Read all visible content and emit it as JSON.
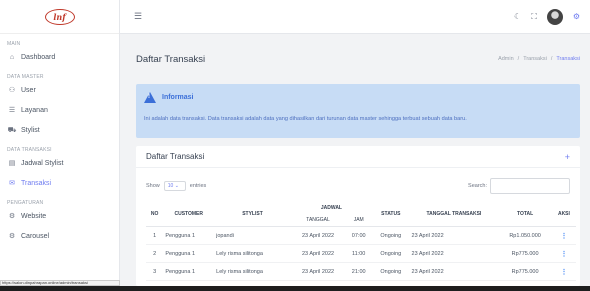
{
  "logo_text": "lnf",
  "sidebar": {
    "sections": [
      {
        "title": "MAIN",
        "items": [
          {
            "label": "Dashboard",
            "icon": "home-icon",
            "glyph": "⌂",
            "active": false
          }
        ]
      },
      {
        "title": "DATA MASTER",
        "items": [
          {
            "label": "User",
            "icon": "users-icon",
            "glyph": "⚇",
            "active": false
          },
          {
            "label": "Layanan",
            "icon": "list-icon",
            "glyph": "☰",
            "active": false
          },
          {
            "label": "Stylist",
            "icon": "car-icon",
            "glyph": "⛟",
            "active": false
          }
        ]
      },
      {
        "title": "DATA TRANSAKSI",
        "items": [
          {
            "label": "Jadwal Stylist",
            "icon": "clipboard-icon",
            "glyph": "▤",
            "active": false
          },
          {
            "label": "Transaksi",
            "icon": "message-icon",
            "glyph": "✉",
            "active": true
          }
        ]
      },
      {
        "title": "PENGATURAN",
        "items": [
          {
            "label": "Website",
            "icon": "gears-icon",
            "glyph": "⚙",
            "active": false
          },
          {
            "label": "Carousel",
            "icon": "gears-icon",
            "glyph": "⚙",
            "active": false
          }
        ]
      }
    ]
  },
  "status_url": "https://salon.dinpahrapan.online/admin/transaksi",
  "topbar": {
    "icons": [
      "moon-icon",
      "fullscreen-icon",
      "avatar",
      "settings-icon"
    ]
  },
  "page": {
    "title": "Daftar Transaksi",
    "breadcrumb": [
      "Admin",
      "Transaksi",
      "Transaksi"
    ]
  },
  "alert": {
    "title": "Informasi",
    "text": "Ini adalah data transaksi. Data transaksi adalah data yang dihasilkan dari turunan data master sehingga terbuat sebuah data baru."
  },
  "card": {
    "title": "Daftar Transaksi",
    "show_label": "Show",
    "entries_value": "10",
    "entries_label": "entries",
    "search_label": "Search:",
    "search_value": ""
  },
  "table": {
    "headers": {
      "no": "NO",
      "customer": "CUSTOMER",
      "stylist": "STYLIST",
      "jadwal": "JADWAL",
      "tanggal": "TANGGAL",
      "jam": "JAM",
      "status": "STATUS",
      "tanggal_transaksi": "TANGGAL TRANSAKSI",
      "total": "TOTAL",
      "aksi": "AKSI"
    },
    "rows": [
      {
        "no": "1",
        "customer": "Pengguna 1",
        "stylist": "jopandi",
        "tanggal": "23 April 2022",
        "jam": "07:00",
        "status": "Ongoing",
        "tanggal_transaksi": "23 April 2022",
        "total": "Rp1.050.000"
      },
      {
        "no": "2",
        "customer": "Pengguna 1",
        "stylist": "Lely risma silitonga",
        "tanggal": "23 April 2022",
        "jam": "11:00",
        "status": "Ongoing",
        "tanggal_transaksi": "23 April 2022",
        "total": "Rp775.000"
      },
      {
        "no": "3",
        "customer": "Pengguna 1",
        "stylist": "Lely risma silitonga",
        "tanggal": "23 April 2022",
        "jam": "21:00",
        "status": "Ongoing",
        "tanggal_transaksi": "23 April 2022",
        "total": "Rp775.000"
      }
    ]
  },
  "colors": {
    "accent": "#6f7cf0",
    "alert_bg": "#c7dcf5",
    "alert_text": "#3b6fd8"
  }
}
